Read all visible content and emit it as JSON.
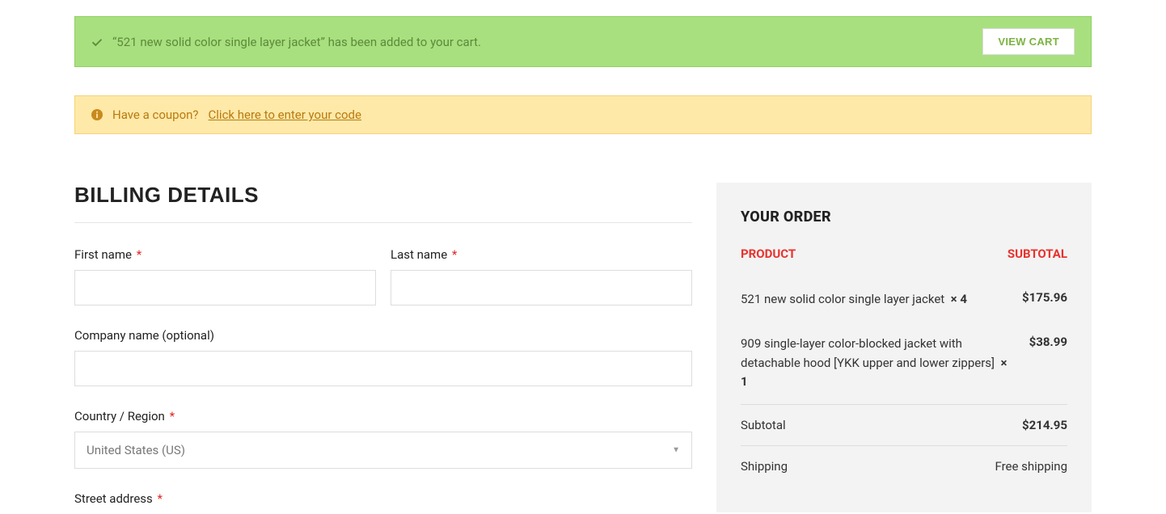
{
  "alerts": {
    "success_msg": "“521 new solid color single layer jacket” has been added to your cart.",
    "view_cart": "VIEW CART",
    "coupon_prompt": "Have a coupon?",
    "coupon_link": "Click here to enter your code"
  },
  "billing": {
    "heading": "BILLING DETAILS",
    "first_name_label": "First name",
    "last_name_label": "Last name",
    "company_label": "Company name (optional)",
    "country_label": "Country / Region",
    "country_value": "United States (US)",
    "street_label": "Street address"
  },
  "order": {
    "heading": "YOUR ORDER",
    "col_product": "PRODUCT",
    "col_subtotal": "SUBTOTAL",
    "items": [
      {
        "name": "521 new solid color single layer jacket",
        "qty": "× 4",
        "price": "$175.96"
      },
      {
        "name": "909 single-layer color-blocked jacket with detachable hood [YKK upper and lower zippers]",
        "qty": "× 1",
        "price": "$38.99"
      }
    ],
    "subtotal_label": "Subtotal",
    "subtotal_value": "$214.95",
    "shipping_label": "Shipping",
    "shipping_value": "Free shipping"
  }
}
